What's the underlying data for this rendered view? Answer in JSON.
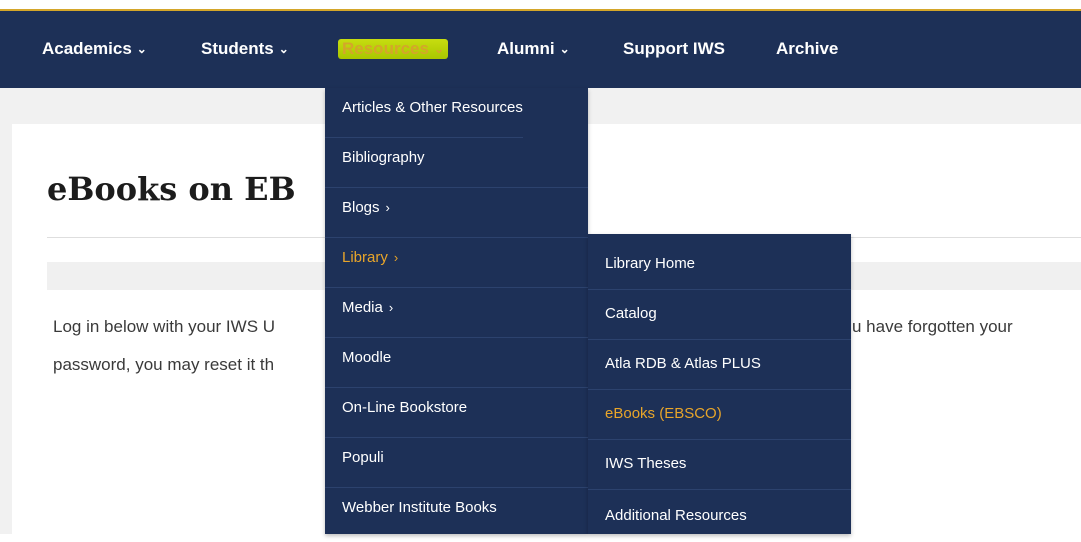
{
  "nav": {
    "items": [
      {
        "label": "Academics",
        "chevron": "⌄"
      },
      {
        "label": "Students",
        "chevron": "⌄"
      },
      {
        "label": "Resources",
        "chevron": "⌄"
      },
      {
        "label": "Alumni",
        "chevron": "⌄"
      },
      {
        "label": "Support IWS",
        "chevron": ""
      },
      {
        "label": "Archive",
        "chevron": ""
      }
    ]
  },
  "page": {
    "title": "eBooks on EB",
    "line1_left": "Log in below with your IWS U",
    "line1_right": "u have forgotten your",
    "line2_left": "password, you may reset it th"
  },
  "resources_menu": {
    "items": [
      {
        "label": "Articles & Other Resources",
        "arrow": ""
      },
      {
        "label": "Bibliography",
        "arrow": ""
      },
      {
        "label": "Blogs",
        "arrow": "›"
      },
      {
        "label": "Library",
        "arrow": "›"
      },
      {
        "label": "Media",
        "arrow": "›"
      },
      {
        "label": "Moodle",
        "arrow": ""
      },
      {
        "label": "On-Line Bookstore",
        "arrow": ""
      },
      {
        "label": "Populi",
        "arrow": ""
      },
      {
        "label": "Webber Institute Books",
        "arrow": ""
      }
    ]
  },
  "library_menu": {
    "items": [
      {
        "label": "Library Home"
      },
      {
        "label": "Catalog"
      },
      {
        "label": "Atla RDB & Atlas PLUS"
      },
      {
        "label": "eBooks (EBSCO)"
      },
      {
        "label": "IWS Theses"
      },
      {
        "label": "Additional Resources"
      }
    ]
  },
  "colors": {
    "nav_bg": "#1d3057",
    "accent": "#e8a52a",
    "highlight": "#c7dd10"
  }
}
